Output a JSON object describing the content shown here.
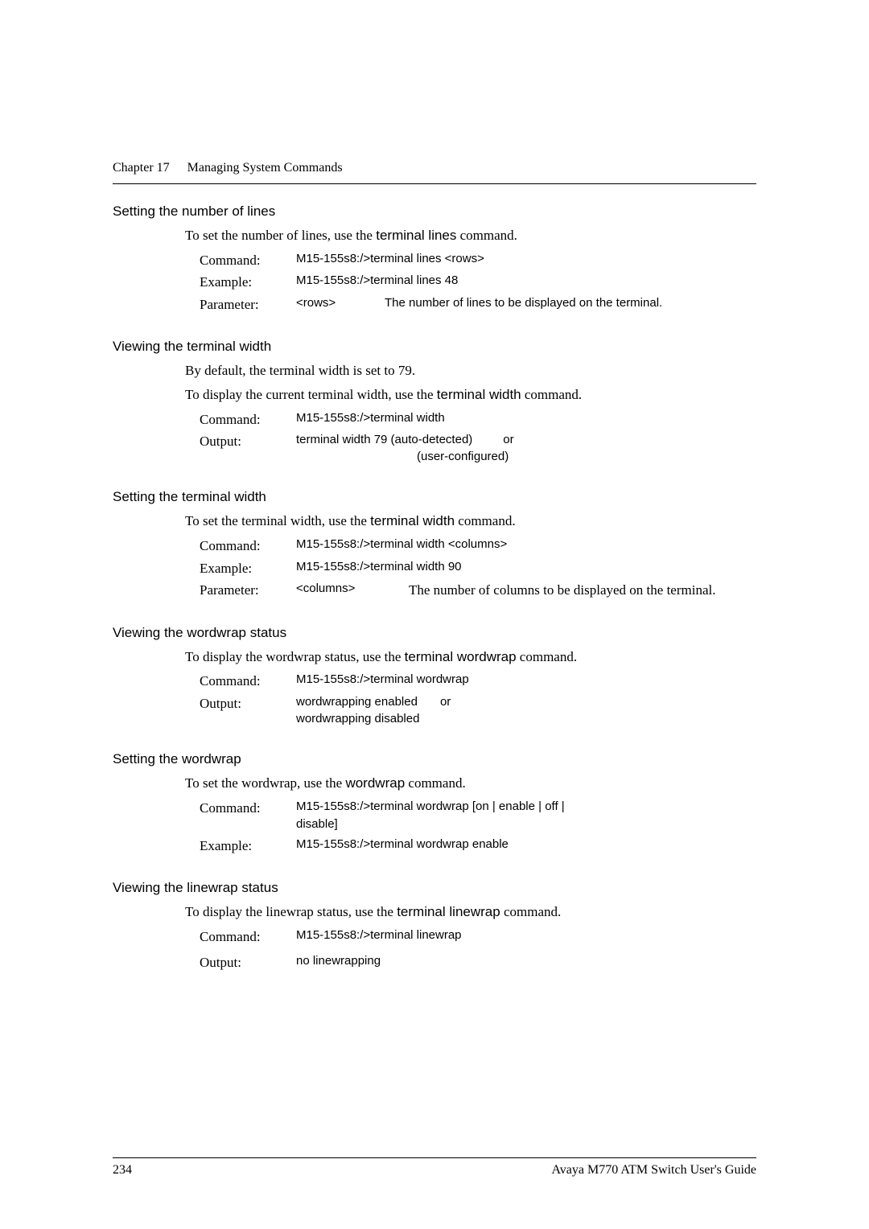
{
  "header": {
    "chapter": "Chapter 17",
    "title": "Managing System Commands"
  },
  "sections": {
    "s1": {
      "title": "Setting the number of lines",
      "intro_pre": "To set the number of lines, use the ",
      "intro_cmd": "terminal lines",
      "intro_post": " command.",
      "command_label": "Command:",
      "command_value": "M15-155s8:/>terminal lines <rows>",
      "example_label": "Example:",
      "example_value": "M15-155s8:/>terminal lines 48",
      "parameter_label": "Parameter:",
      "param_name": "<rows>",
      "param_desc": "The number of lines to be displayed on the terminal."
    },
    "s2": {
      "title": "Viewing the terminal width",
      "line1": "By default, the terminal width is set to 79.",
      "intro_pre": "To display the current terminal width, use the ",
      "intro_cmd": "terminal width",
      "intro_post": " command.",
      "command_label": "Command:",
      "command_value": "M15-155s8:/>terminal width",
      "output_label": "Output:",
      "output_line1a": "terminal width 79  (auto-detected)",
      "output_or": "or",
      "output_line2": "(user-configured)"
    },
    "s3": {
      "title": "Setting the terminal width",
      "intro_pre": "To set the terminal width, use the ",
      "intro_cmd": "terminal width",
      "intro_post": " command.",
      "command_label": "Command:",
      "command_value": "M15-155s8:/>terminal width <columns>",
      "example_label": "Example:",
      "example_value": "M15-155s8:/>terminal width 90",
      "parameter_label": "Parameter:",
      "param_name": "<columns>",
      "param_desc": "The number of columns to be displayed on the terminal."
    },
    "s4": {
      "title": "Viewing the wordwrap status",
      "intro_pre": "To display the wordwrap status, use the ",
      "intro_cmd": "terminal wordwrap",
      "intro_post": " command.",
      "command_label": "Command:",
      "command_value": "M15-155s8:/>terminal wordwrap",
      "output_label": "Output:",
      "output_line1a": "wordwrapping enabled",
      "output_or": "or",
      "output_line2": "wordwrapping disabled"
    },
    "s5": {
      "title": "Setting the wordwrap",
      "intro_pre": "To set the wordwrap, use the ",
      "intro_cmd": "wordwrap",
      "intro_post": " command.",
      "command_label": "Command:",
      "command_value": "M15-155s8:/>terminal wordwrap [on | enable | off | disable]",
      "example_label": "Example:",
      "example_value": "M15-155s8:/>terminal wordwrap enable"
    },
    "s6": {
      "title": "Viewing the linewrap status",
      "intro_pre": "To display the linewrap status, use the ",
      "intro_cmd": "terminal linewrap",
      "intro_post": " command.",
      "command_label": "Command:",
      "command_value": "M15-155s8:/>terminal linewrap",
      "output_label": "Output:",
      "output_value": "no linewrapping"
    }
  },
  "footer": {
    "page": "234",
    "guide": "Avaya M770 ATM Switch User's Guide"
  }
}
